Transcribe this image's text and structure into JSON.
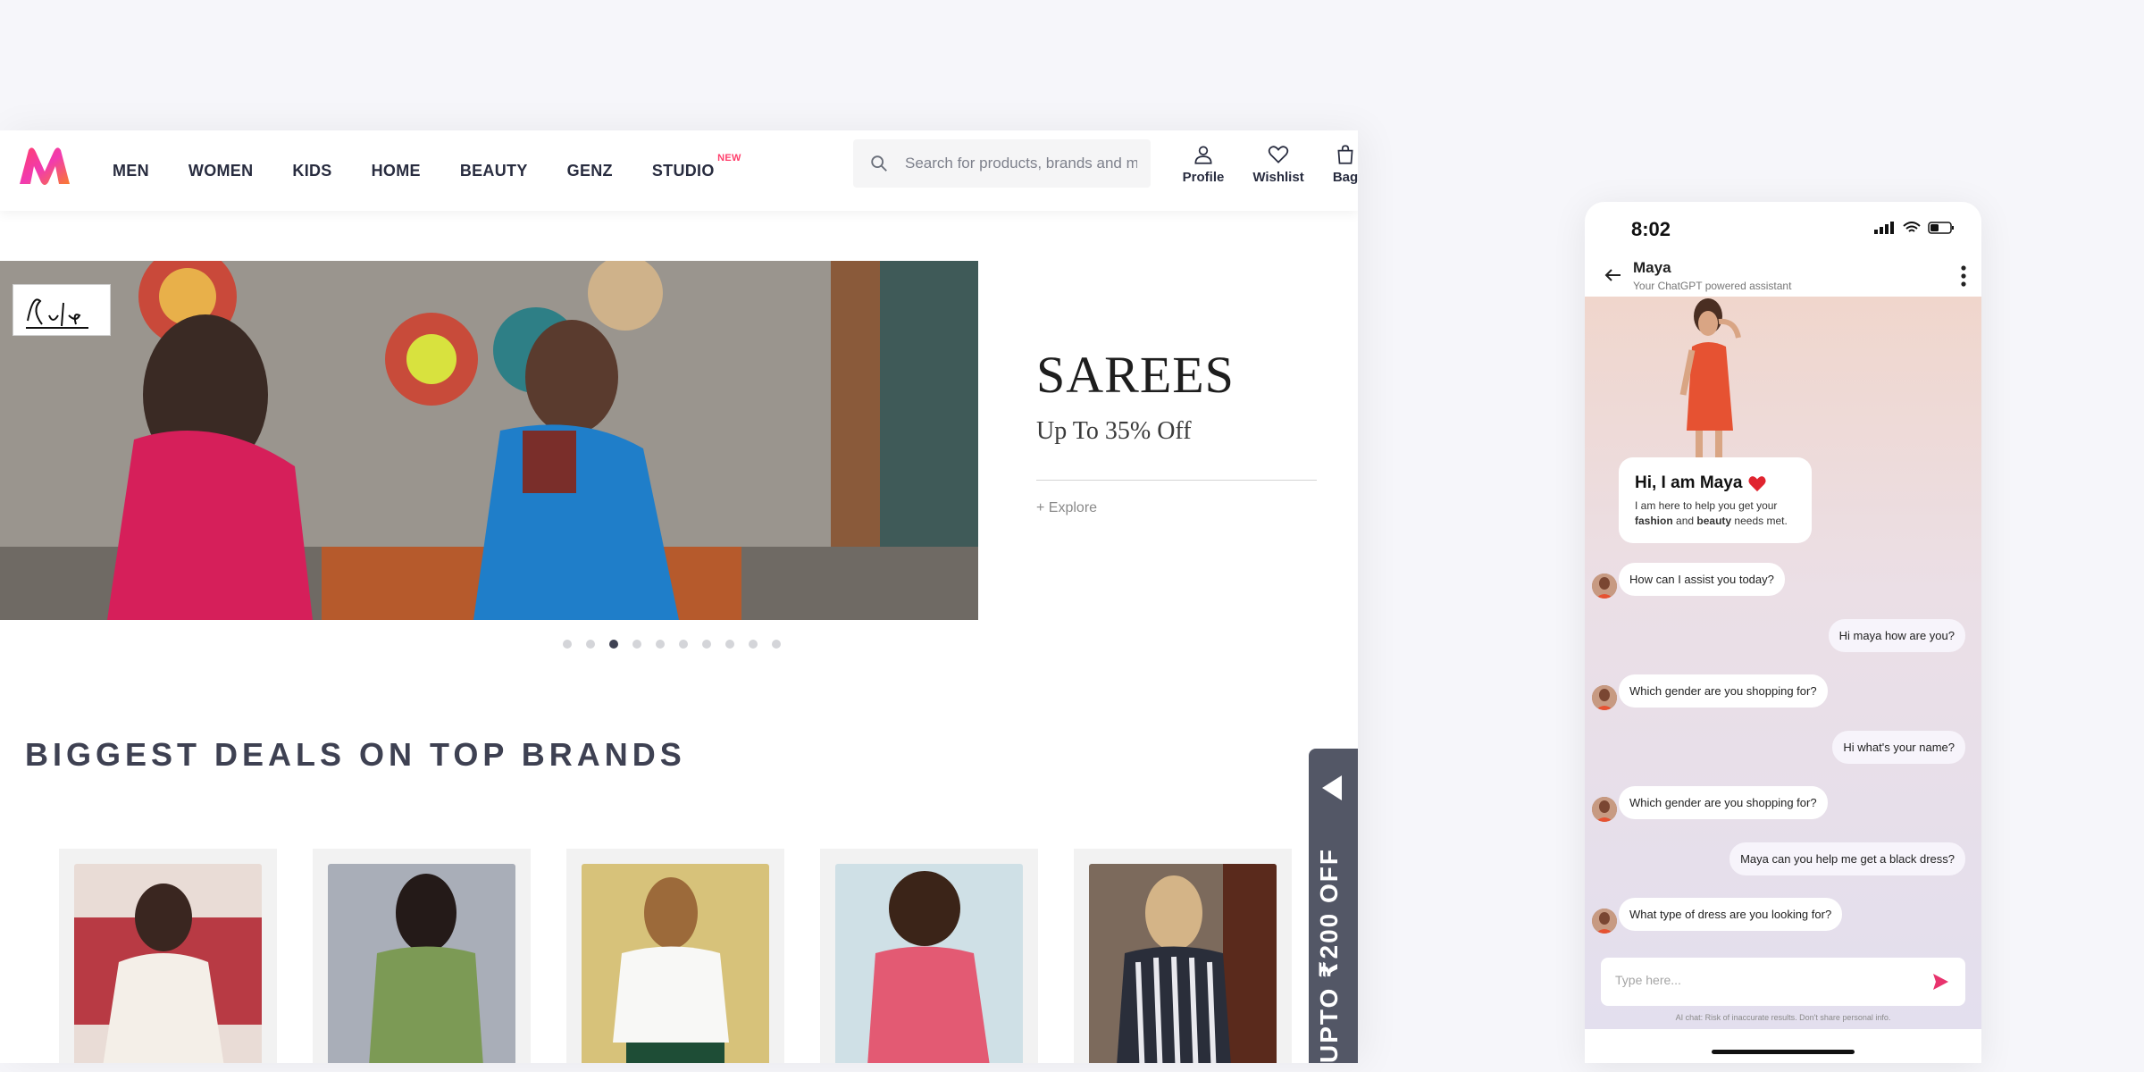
{
  "nav": {
    "items": [
      "MEN",
      "WOMEN",
      "KIDS",
      "HOME",
      "BEAUTY",
      "GENZ",
      "STUDIO"
    ],
    "studio_badge": "NEW"
  },
  "search": {
    "placeholder": "Search for products, brands and more"
  },
  "actions": {
    "profile": "Profile",
    "wishlist": "Wishlist",
    "bag": "Bag"
  },
  "banner": {
    "title": "SAREES",
    "subtitle": "Up To 35% Off",
    "explore": "+ Explore",
    "brand_badge": "Sutu",
    "slide_count": 10,
    "active_slide": 3
  },
  "deals": {
    "title": "BIGGEST DEALS ON TOP BRANDS"
  },
  "side_tab": {
    "label": "UPTO ₹200 OFF"
  },
  "phone": {
    "time": "8:02",
    "assistant_name": "Maya",
    "assistant_subtitle": "Your ChatGPT powered assistant",
    "intro_title": "Hi, I am Maya",
    "intro_line1": "I am here to help you get your",
    "intro_fashion": "fashion",
    "intro_and": "and",
    "intro_beauty": "beauty",
    "intro_end": "needs met.",
    "messages": [
      {
        "from": "bot",
        "text": "How can I assist you today?"
      },
      {
        "from": "user",
        "text": "Hi maya how are you?"
      },
      {
        "from": "bot",
        "text": "Which gender are you shopping for?"
      },
      {
        "from": "user",
        "text": "Hi what's your name?"
      },
      {
        "from": "bot",
        "text": "Which gender are you shopping for?"
      },
      {
        "from": "user",
        "text": "Maya can you help me get a black dress?"
      },
      {
        "from": "bot",
        "text": "What type of dress are you looking for?"
      }
    ],
    "composer_placeholder": "Type here...",
    "disclaimer": "AI chat: Risk of inaccurate results. Don't share personal info."
  },
  "colors": {
    "brand_pink": "#ff3f6c",
    "brand_orange": "#f97c2c",
    "nav_text": "#282c3f",
    "send": "#e8336d"
  },
  "icons": [
    "search-icon",
    "profile-icon",
    "wishlist-heart-icon",
    "bag-icon",
    "back-arrow-icon",
    "more-vertical-icon",
    "send-icon",
    "signal-icon",
    "wifi-icon",
    "battery-icon"
  ]
}
